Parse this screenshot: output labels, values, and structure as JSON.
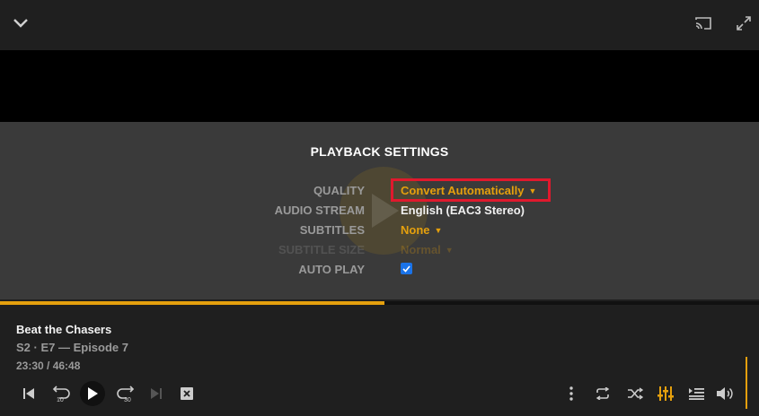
{
  "icons": {
    "collapse": "chevron-down-icon",
    "cast": "cast-icon",
    "fullscreen": "fullscreen-icon",
    "previous": "skip-previous-icon",
    "replay": "replay-10-icon",
    "play": "play-icon",
    "forward": "forward-30-icon",
    "next": "skip-next-icon",
    "stop": "close-box-icon",
    "more": "more-vertical-icon",
    "repeat": "repeat-icon",
    "shuffle": "shuffle-icon",
    "settings": "equalizer-icon",
    "queue": "playlist-icon",
    "volume": "volume-icon"
  },
  "playback_settings": {
    "title": "PLAYBACK SETTINGS",
    "quality": {
      "label": "QUALITY",
      "value": "Convert Automatically"
    },
    "audio_stream": {
      "label": "AUDIO STREAM",
      "value": "English (EAC3 Stereo)"
    },
    "subtitles": {
      "label": "SUBTITLES",
      "value": "None"
    },
    "subtitle_size": {
      "label": "SUBTITLE SIZE",
      "value": "Normal"
    },
    "auto_play": {
      "label": "AUTO PLAY",
      "checked": true
    }
  },
  "player": {
    "title": "Beat the Chasers",
    "episode": "S2 · E7 — Episode 7",
    "time": "23:30 / 46:48",
    "progress": 0.506,
    "replay_seconds": "10",
    "forward_seconds": "30"
  },
  "colors": {
    "accent": "#e5a00d",
    "highlight_box": "#e0192d",
    "panel": "#3a3a3a",
    "background": "#1f1f1f"
  }
}
